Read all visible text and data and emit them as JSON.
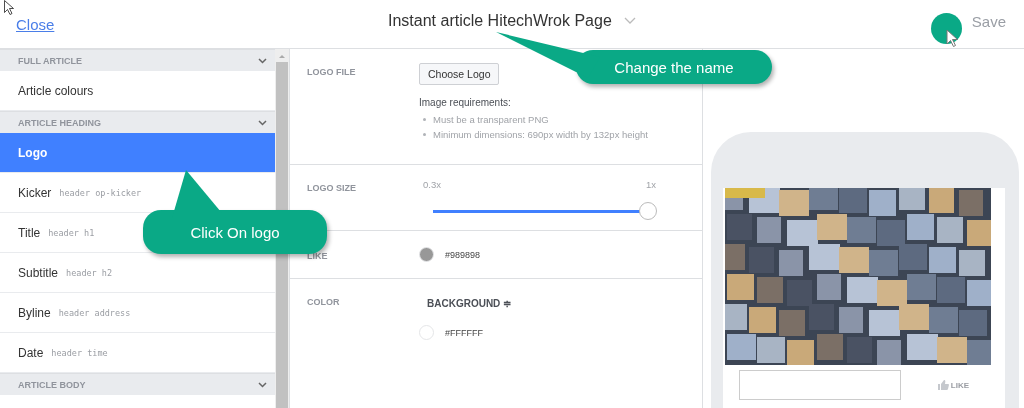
{
  "header": {
    "close": "Close",
    "title": "Instant article HitechWrok Page",
    "save": "Save"
  },
  "sidebar": {
    "items": [
      {
        "kind": "section",
        "label": "FULL ARTICLE",
        "expanded": true
      },
      {
        "kind": "item",
        "label": "Article colours",
        "selected": false
      },
      {
        "kind": "section",
        "label": "ARTICLE HEADING",
        "expanded": true
      },
      {
        "kind": "item",
        "label": "Logo",
        "selected": true
      },
      {
        "kind": "item",
        "label": "Kicker",
        "hint": "header op-kicker",
        "selected": false
      },
      {
        "kind": "item",
        "label": "Title",
        "hint": "header h1",
        "selected": false
      },
      {
        "kind": "item",
        "label": "Subtitle",
        "hint": "header h2",
        "selected": false
      },
      {
        "kind": "item",
        "label": "Byline",
        "hint": "header address",
        "selected": false
      },
      {
        "kind": "item",
        "label": "Date",
        "hint": "header time",
        "selected": false
      },
      {
        "kind": "section",
        "label": "ARTICLE BODY",
        "expanded": true
      }
    ]
  },
  "settings": [
    {
      "kind": "file",
      "label": "LOGO FILE",
      "button": "Choose Logo",
      "note": "Image requirements:",
      "requirements": [
        "Must be a transparent PNG",
        "Minimum dimensions: 690px width by 132px height"
      ]
    },
    {
      "kind": "slider",
      "label": "LOGO SIZE",
      "min": "0.3x",
      "max": "1x",
      "level": 1.0
    },
    {
      "kind": "color",
      "label": "LIKE",
      "swatches": [
        {
          "color": "#989898",
          "value": "#989898"
        }
      ]
    },
    {
      "kind": "color",
      "label": "COLOR",
      "dropdown": "BACKGROUND ≑",
      "swatches": [
        {
          "color": "#ffffff",
          "value": "#FFFFFF"
        }
      ]
    }
  ],
  "preview": {
    "like": "LIKE"
  },
  "callouts": [
    {
      "text": "Change the name"
    },
    {
      "text": "Click On logo"
    }
  ]
}
